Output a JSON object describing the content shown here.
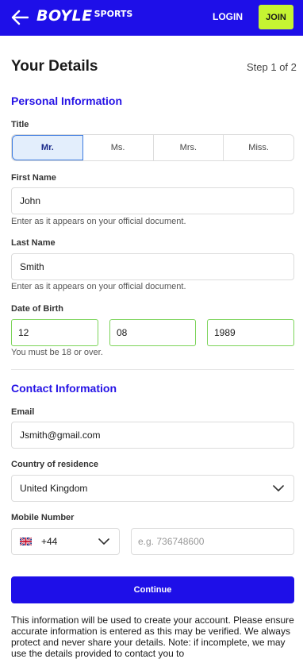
{
  "header": {
    "logo_main": "BOYLE",
    "logo_sub": "SPORTS",
    "login_label": "LOGIN",
    "join_label": "JOIN"
  },
  "page": {
    "title": "Your Details",
    "step": "Step 1 of 2"
  },
  "personal": {
    "section_title": "Personal Information",
    "title_label": "Title",
    "title_options": [
      "Mr.",
      "Ms.",
      "Mrs.",
      "Miss."
    ],
    "title_selected": "Mr.",
    "first_name_label": "First Name",
    "first_name_value": "John",
    "first_name_helper": "Enter as it appears on your official document.",
    "last_name_label": "Last Name",
    "last_name_value": "Smith",
    "last_name_helper": "Enter as it appears on your official document.",
    "dob_label": "Date of Birth",
    "dob_day": "12",
    "dob_month": "08",
    "dob_year": "1989",
    "dob_helper": "You must be 18 or over."
  },
  "contact": {
    "section_title": "Contact Information",
    "email_label": "Email",
    "email_value": "Jsmith@gmail.com",
    "country_label": "Country of residence",
    "country_value": "United Kingdom",
    "mobile_label": "Mobile Number",
    "dial_code": "+44",
    "mobile_placeholder": "e.g. 736748600"
  },
  "actions": {
    "continue_label": "Continue"
  },
  "disclaimer": "This information will be used to create your account. Please ensure accurate information is entered as this may be verified. We always protect and never share your details. Note: if incomplete, we may use the details provided to contact you to",
  "colors": {
    "brand": "#1e0fe8",
    "join_accent": "#c6f432",
    "section_title": "#2512e5",
    "valid_border": "#7cd45a",
    "selected_bg": "#e3eefc"
  },
  "icons": [
    "back-arrow-icon",
    "chevron-down-icon",
    "uk-flag-icon"
  ]
}
